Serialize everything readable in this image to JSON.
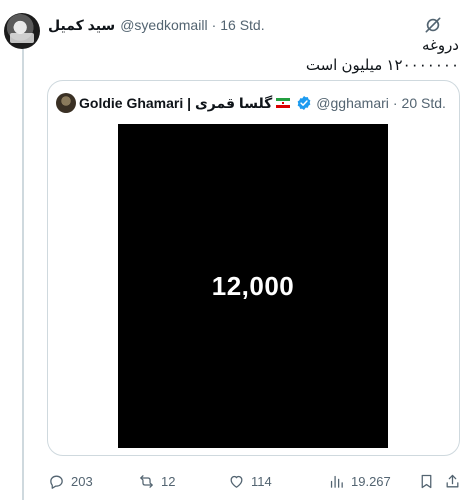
{
  "tweet": {
    "author_name": "سید کمیل",
    "handle": "@syedkomaill",
    "separator": "·",
    "time": "16 Std.",
    "text_line1": "دروغه",
    "text_line2": "۱۲۰۰۰۰۰۰۰ میلیون است"
  },
  "quoted": {
    "author_name": "Goldie Ghamari | گلسا قمری",
    "handle": "@gghamari",
    "separator": "·",
    "time": "20 Std.",
    "verified": true,
    "image_text": "12,000"
  },
  "actions": {
    "replies": "203",
    "reposts": "12",
    "likes": "114",
    "views": "19.267"
  },
  "colors": {
    "text_primary": "#0f1419",
    "text_secondary": "#536471",
    "verified_blue": "#1d9bf0",
    "border": "#cfd9de"
  }
}
